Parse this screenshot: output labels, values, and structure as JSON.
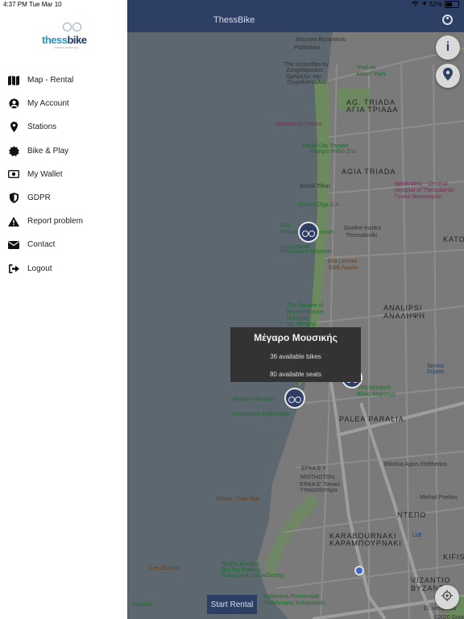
{
  "status_bar": {
    "time": "4:37 PM",
    "date": "Tue Mar 10",
    "battery": "52%",
    "battery_level": 0.52
  },
  "app": {
    "title": "ThessBike",
    "start_rental_label": "Start Rental"
  },
  "logo": {
    "word_left": "thess",
    "word_right": "bike",
    "tagline": "ποδήλατο μετακίνησης"
  },
  "sidebar": {
    "items": [
      {
        "label": "Map - Rental",
        "icon": "map-icon"
      },
      {
        "label": "My Account",
        "icon": "account-icon"
      },
      {
        "label": "Stations",
        "icon": "location-pin-icon"
      },
      {
        "label": "Bike & Play",
        "icon": "badge-icon"
      },
      {
        "label": "My Wallet",
        "icon": "wallet-icon"
      },
      {
        "label": "GDPR",
        "icon": "shield-icon"
      },
      {
        "label": "Report problem",
        "icon": "warning-icon"
      },
      {
        "label": "Contact",
        "icon": "envelope-icon"
      },
      {
        "label": "Logout",
        "icon": "logout-icon"
      }
    ]
  },
  "map": {
    "labels": [
      {
        "text": "Mousein Byzantinou",
        "cls": ""
      },
      {
        "text": "Politismou",
        "cls": ""
      },
      {
        "text": "The Umbrellas by",
        "cls": ""
      },
      {
        "text": "Zongolopoulos",
        "cls": ""
      },
      {
        "text": "Ομπρέλες του",
        "cls": ""
      },
      {
        "text": "Ζογγολόπουλου",
        "cls": ""
      },
      {
        "text": "\"Pedion",
        "cls": "green"
      },
      {
        "text": "Areos\" Park",
        "cls": "green"
      },
      {
        "text": "AG. TRIADA",
        "cls": "big"
      },
      {
        "text": "ΑΓΙΑ ΤΡΙΑΔΑ",
        "cls": "big"
      },
      {
        "text": "Makedonia Palace",
        "cls": "pink"
      },
      {
        "text": "Radio City Theater",
        "cls": "green"
      },
      {
        "text": "Θέατρο Ράδιο Σίτυ",
        "cls": "green"
      },
      {
        "text": "AGIA TRIADA",
        "cls": "big"
      },
      {
        "text": "Scholi Tifion",
        "cls": ""
      },
      {
        "text": "Ippokrateio - General",
        "cls": "pink"
      },
      {
        "text": "Hospital of Thessaloniki",
        "cls": "pink"
      },
      {
        "text": "Γενικό Νοσοκομείο",
        "cls": "pink"
      },
      {
        "text": "Queen Olga S.A",
        "cls": "green"
      },
      {
        "text": "Folk",
        "cls": "green"
      },
      {
        "text": "Ethnological Museum",
        "cls": "green"
      },
      {
        "text": "Λαογραφικό",
        "cls": "green"
      },
      {
        "text": "Εθνολογικό Μουσείο",
        "cls": "green"
      },
      {
        "text": "Goethe-Institut",
        "cls": ""
      },
      {
        "text": "Thessaloniki",
        "cls": ""
      },
      {
        "text": "KATO",
        "cls": "big"
      },
      {
        "text": "Elia Lemoni",
        "cls": "orange"
      },
      {
        "text": "Ελιά Λεμόνι",
        "cls": "orange"
      },
      {
        "text": "ANALIPSI",
        "cls": "big"
      },
      {
        "text": "ΑΝΑΛΗΨΗ",
        "cls": "big"
      },
      {
        "text": "The Garden of",
        "cls": "green"
      },
      {
        "text": "Remembrance",
        "cls": "green"
      },
      {
        "text": "Ο Κήπος",
        "cls": "green"
      },
      {
        "text": "της Μνήμης",
        "cls": "green"
      },
      {
        "text": "Seirios",
        "cls": "blue"
      },
      {
        "text": "Σείριος",
        "cls": "blue"
      },
      {
        "text": "Villa Mordoch",
        "cls": "green"
      },
      {
        "text": "Βίλλα Μορντώχ",
        "cls": "green"
      },
      {
        "text": "Megaro Mousikis",
        "cls": "green"
      },
      {
        "text": "Poseidonio Kolimvitirio",
        "cls": "green"
      },
      {
        "text": "PALEA PARALIA",
        "cls": "big"
      },
      {
        "text": "Ekklisia Agios Eleftherios",
        "cls": ""
      },
      {
        "text": "EFKA E Y",
        "cls": ""
      },
      {
        "text": "MISTHOTON...",
        "cls": ""
      },
      {
        "text": "ΕΦΚΑ Ε' Τοπικό",
        "cls": ""
      },
      {
        "text": "Υποκατάστημα",
        "cls": ""
      },
      {
        "text": "Sharki - Cafe Bar",
        "cls": "orange"
      },
      {
        "text": "ΝΤΕΠΩ",
        "cls": "big"
      },
      {
        "text": "Michail Psellou",
        "cls": ""
      },
      {
        "text": "KARABOURNAKI",
        "cls": "big"
      },
      {
        "text": "ΚΑΡΑΜΠΟΥΡΝΑΚΙ",
        "cls": "big"
      },
      {
        "text": "Lidl",
        "cls": "blue"
      },
      {
        "text": "KIFISI",
        "cls": "big"
      },
      {
        "text": "TenPin Bowling",
        "cls": "green"
      },
      {
        "text": "Ten Pin Bowling -",
        "cls": "green"
      },
      {
        "text": "Πολυχώρος Διασκέδασης",
        "cls": "green"
      },
      {
        "text": "Les Zazous",
        "cls": "orange"
      },
      {
        "text": "Kalamaria Promenade",
        "cls": "green"
      },
      {
        "text": "Πεζόδρομος Καλαμαριάς",
        "cls": "green"
      },
      {
        "text": "VIZANTIO",
        "cls": "big"
      },
      {
        "text": "ΒΥΖΑΝΤΙΟ",
        "cls": "big"
      },
      {
        "text": "©2020 Google",
        "cls": ""
      },
      {
        "text": "El. Venizelou",
        "cls": ""
      },
      {
        "text": "Palataki",
        "cls": "green"
      }
    ]
  },
  "popup": {
    "title": "Μέγαρο Μουσικής",
    "bikes": "36 available bikes",
    "seats": "80 available seats"
  }
}
